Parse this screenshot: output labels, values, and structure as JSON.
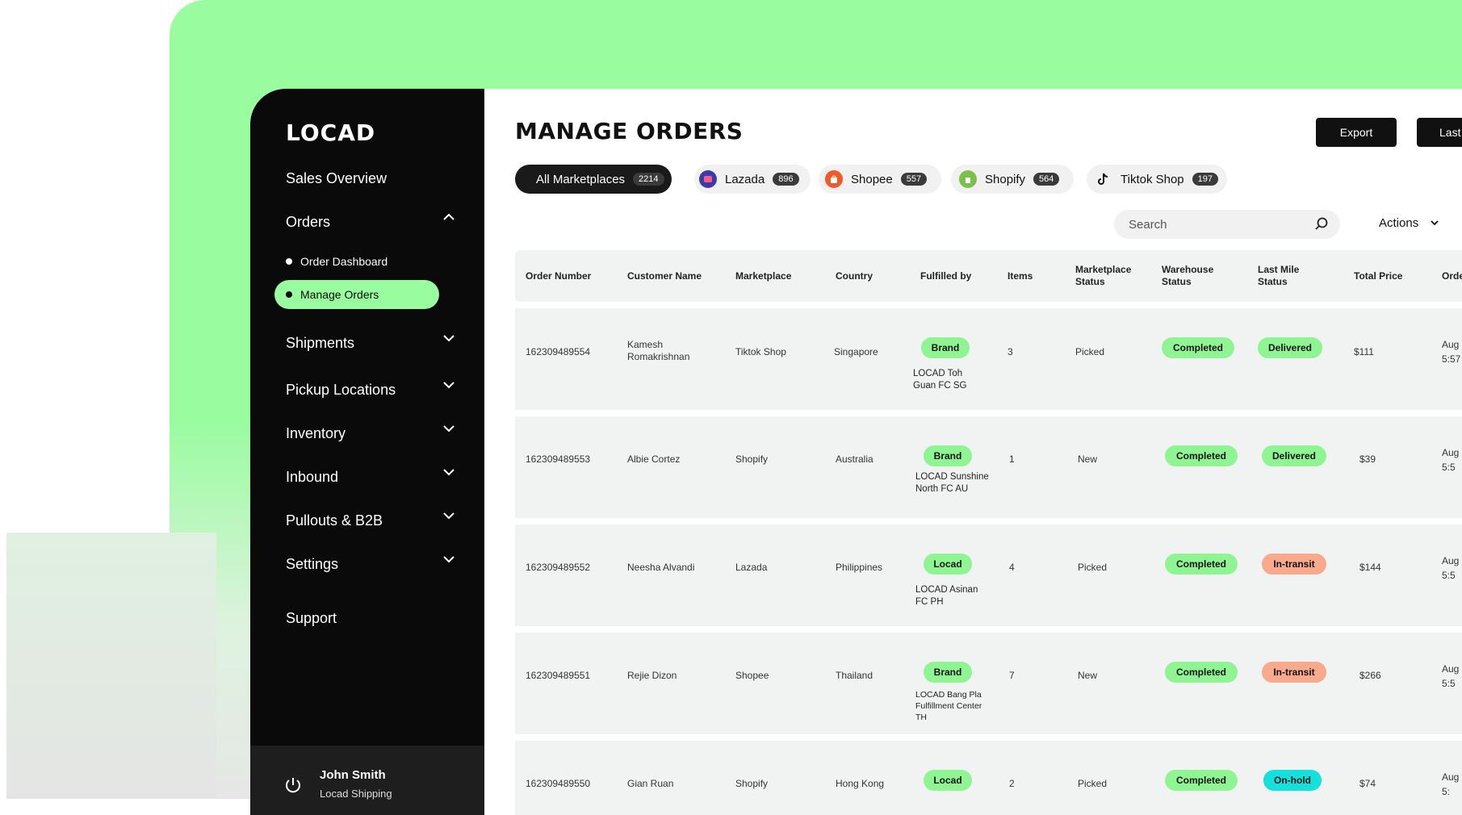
{
  "app": {
    "logo": "LOCAD"
  },
  "sidebar": {
    "items": [
      {
        "label": "Sales Overview"
      },
      {
        "label": "Orders",
        "expanded": true,
        "children": [
          {
            "label": "Order Dashboard"
          },
          {
            "label": "Manage Orders",
            "active": true
          }
        ]
      },
      {
        "label": "Shipments"
      },
      {
        "label": "Pickup Locations"
      },
      {
        "label": "Inventory"
      },
      {
        "label": "Inbound"
      },
      {
        "label": "Pullouts & B2B"
      },
      {
        "label": "Settings"
      },
      {
        "label": "Support"
      }
    ],
    "user": {
      "name": "John Smith",
      "org": "Locad Shipping"
    }
  },
  "header": {
    "title": "MANAGE ORDERS",
    "export_label": "Export",
    "last_label": "Last"
  },
  "marketplaces": [
    {
      "label": "All Marketplaces",
      "count": "2214",
      "active": true
    },
    {
      "label": "Lazada",
      "count": "896",
      "icon": "lazada-icon",
      "color": "#3a3aa8"
    },
    {
      "label": "Shopee",
      "count": "557",
      "icon": "shopee-icon",
      "color": "#f05a28"
    },
    {
      "label": "Shopify",
      "count": "564",
      "icon": "shopify-icon",
      "color": "#7bc04a"
    },
    {
      "label": "Tiktok Shop",
      "count": "197",
      "icon": "tiktok-icon",
      "color": "#111111"
    }
  ],
  "search": {
    "placeholder": "Search"
  },
  "actions_label": "Actions",
  "table": {
    "columns": [
      {
        "label": "Order Number"
      },
      {
        "label": "Customer Name"
      },
      {
        "label": "Marketplace"
      },
      {
        "label": "Country"
      },
      {
        "label": "Fulfilled by"
      },
      {
        "label": "Items"
      },
      {
        "label": "Marketplace Status"
      },
      {
        "label": "Warehouse Status"
      },
      {
        "label": "Last Mile Status"
      },
      {
        "label": "Total Price"
      },
      {
        "label": "Orde"
      }
    ],
    "rows": [
      {
        "order": "162309489554",
        "customer": "Kamesh Romakrishnan",
        "marketplace": "Tiktok Shop",
        "country": "Singapore",
        "fulfilled": "Brand",
        "location": "LOCAD Toh Guan FC SG",
        "items": "3",
        "mp_status": "Picked",
        "wh_status": "Completed",
        "lm_status": "Delivered",
        "lm_color": "green",
        "price": "$111",
        "date": "Aug",
        "time": "5:57"
      },
      {
        "order": "162309489553",
        "customer": "Albie Cortez",
        "marketplace": "Shopify",
        "country": "Australia",
        "fulfilled": "Brand",
        "location": "LOCAD Sunshine North FC AU",
        "items": "1",
        "mp_status": "New",
        "wh_status": "Completed",
        "lm_status": "Delivered",
        "lm_color": "green",
        "price": "$39",
        "date": "Aug",
        "time": "5:5"
      },
      {
        "order": "162309489552",
        "customer": "Neesha Alvandi",
        "marketplace": "Lazada",
        "country": "Philippines",
        "fulfilled": "Locad",
        "location": "LOCAD Asinan FC PH",
        "items": "4",
        "mp_status": "Picked",
        "wh_status": "Completed",
        "lm_status": "In-transit",
        "lm_color": "orange",
        "price": "$144",
        "date": "Aug",
        "time": "5:5"
      },
      {
        "order": "162309489551",
        "customer": "Rejie Dizon",
        "marketplace": "Shopee",
        "country": "Thailand",
        "fulfilled": "Brand",
        "location": "LOCAD Bang Pla Fulfillment Center TH",
        "items": "7",
        "mp_status": "New",
        "wh_status": "Completed",
        "lm_status": "In-transit",
        "lm_color": "orange",
        "price": "$266",
        "date": "Aug",
        "time": "5:5"
      },
      {
        "order": "162309489550",
        "customer": "Gian Ruan",
        "marketplace": "Shopify",
        "country": "Hong Kong",
        "fulfilled": "Locad",
        "location": "",
        "items": "2",
        "mp_status": "Picked",
        "wh_status": "Completed",
        "lm_status": "On-hold",
        "lm_color": "cyan",
        "price": "$74",
        "date": "Aug",
        "time": "5:"
      }
    ]
  },
  "colors": {
    "accent": "#99fc9f",
    "sidebar": "#0a0a0a",
    "pill_green": "#8ff593",
    "pill_orange": "#f9a98c",
    "pill_cyan": "#14e0dc"
  }
}
